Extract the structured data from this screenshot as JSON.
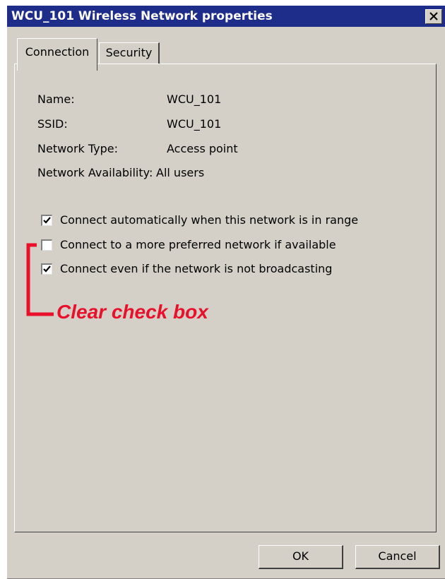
{
  "window": {
    "title": "WCU_101 Wireless Network properties",
    "close_icon": "close-icon"
  },
  "tabs": [
    {
      "label": "Connection",
      "active": true
    },
    {
      "label": "Security",
      "active": false
    }
  ],
  "properties": [
    {
      "label": "Name:",
      "value": "WCU_101"
    },
    {
      "label": "SSID:",
      "value": "WCU_101"
    },
    {
      "label": "Network Type:",
      "value": "Access point"
    },
    {
      "label": "Network Availability:",
      "value": "All users"
    }
  ],
  "options": [
    {
      "label": "Connect automatically when this network is in range",
      "checked": true
    },
    {
      "label": "Connect to a more preferred network if available",
      "checked": false
    },
    {
      "label": "Connect even if the network is not broadcasting",
      "checked": true
    }
  ],
  "annotation": {
    "text": "Clear check box",
    "color": "#e8102a"
  },
  "buttons": {
    "ok": "OK",
    "cancel": "Cancel"
  },
  "colors": {
    "titlebar": "#1f2d8a",
    "dialog_bg": "#d4d0c8"
  }
}
